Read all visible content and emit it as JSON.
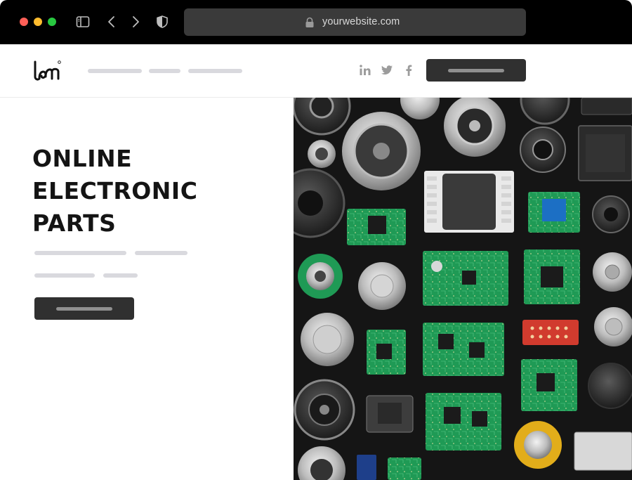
{
  "browser": {
    "url": "yourwebsite.com",
    "icons": [
      "close-dot",
      "minimize-dot",
      "maximize-dot",
      "sidebar-icon",
      "back-icon",
      "forward-icon",
      "shield-icon",
      "lock-icon"
    ]
  },
  "header": {
    "logo_icon": "brand-logo",
    "social_icons": [
      "linkedin-icon",
      "twitter-icon",
      "facebook-icon"
    ]
  },
  "hero": {
    "title_lines": [
      "ONLINE",
      "ELECTRONIC",
      "PARTS"
    ],
    "image": "electronic-components-photo"
  },
  "colors": {
    "chrome_bg": "#000000",
    "urlbar_bg": "#3a3a3a",
    "button_bg": "#303030",
    "placeholder_bar": "#d9d9de",
    "title_text": "#141414",
    "pcb_green": "#1f9a55",
    "image_bg": "#151515"
  }
}
